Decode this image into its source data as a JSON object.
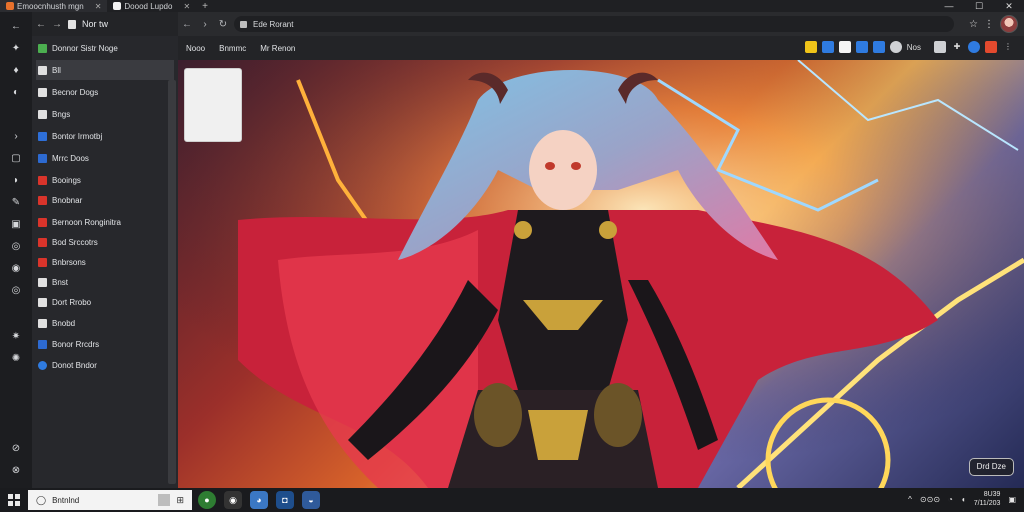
{
  "browser": {
    "tabs": [
      {
        "label": "Emoocnhusth mgn",
        "active": true
      },
      {
        "label": "Doood Lupdo",
        "active": false
      }
    ],
    "new_tab_icon": "plus-icon",
    "window_controls": {
      "minimize": "—",
      "maximize": "☐",
      "close": "✕"
    },
    "address": "Ede Rorant",
    "avatar_icon": "profile-avatar-icon"
  },
  "side_panel": {
    "header_title": "Nor tw",
    "items": [
      {
        "label": "Donnor Sistr Noge",
        "icon": "bookmark-green-icon",
        "color": "#4caf50"
      },
      {
        "label": "Bll",
        "icon": "doc-icon",
        "color": "#e0e0e0",
        "selected": true
      },
      {
        "label": "Becnor Dogs",
        "icon": "doc-icon",
        "color": "#e0e0e0"
      },
      {
        "label": "Bngs",
        "icon": "doc-icon",
        "color": "#e0e0e0"
      },
      {
        "label": "Bontor Irmotbj",
        "icon": "blue-app-icon",
        "color": "#2e6fd8"
      },
      {
        "label": "Mrrc Doos",
        "icon": "blue-square-icon",
        "color": "#2d6ad1"
      },
      {
        "label": "Booings",
        "icon": "red-square-icon",
        "color": "#d9342b"
      },
      {
        "label": "Bnobnar",
        "icon": "red-square-icon",
        "color": "#d9342b"
      },
      {
        "label": "Bernoon Ronginitra",
        "icon": "red-square-icon",
        "color": "#d9342b"
      },
      {
        "label": "Bod Srccotrs",
        "icon": "red-square-icon",
        "color": "#d9342b"
      },
      {
        "label": "Bnbrsons",
        "icon": "red-square-icon",
        "color": "#d9342b"
      },
      {
        "label": "Bnst",
        "icon": "doc-icon",
        "color": "#e0e0e0"
      },
      {
        "label": "Dort Rrobo",
        "icon": "tool-icon",
        "color": "#e0e0e0"
      },
      {
        "label": "Bnobd",
        "icon": "doc-icon",
        "color": "#e0e0e0"
      },
      {
        "label": "Bonor Rrcdrs",
        "icon": "blue-square-icon",
        "color": "#2d6ad1"
      },
      {
        "label": "Donot Bndor",
        "icon": "blue-round-icon",
        "color": "#2f7be0"
      }
    ]
  },
  "bookmarks_bar": {
    "items": [
      "Nooo",
      "Bnmmc",
      "Mr Renon"
    ],
    "right_label": "Nos"
  },
  "content": {
    "corner_badge": "Drd Dze"
  },
  "taskbar": {
    "search_placeholder": "Bntnlnd",
    "tray_text": "⊙⊙⊙",
    "clock_time": "8U39",
    "clock_date": "7/11/203"
  }
}
